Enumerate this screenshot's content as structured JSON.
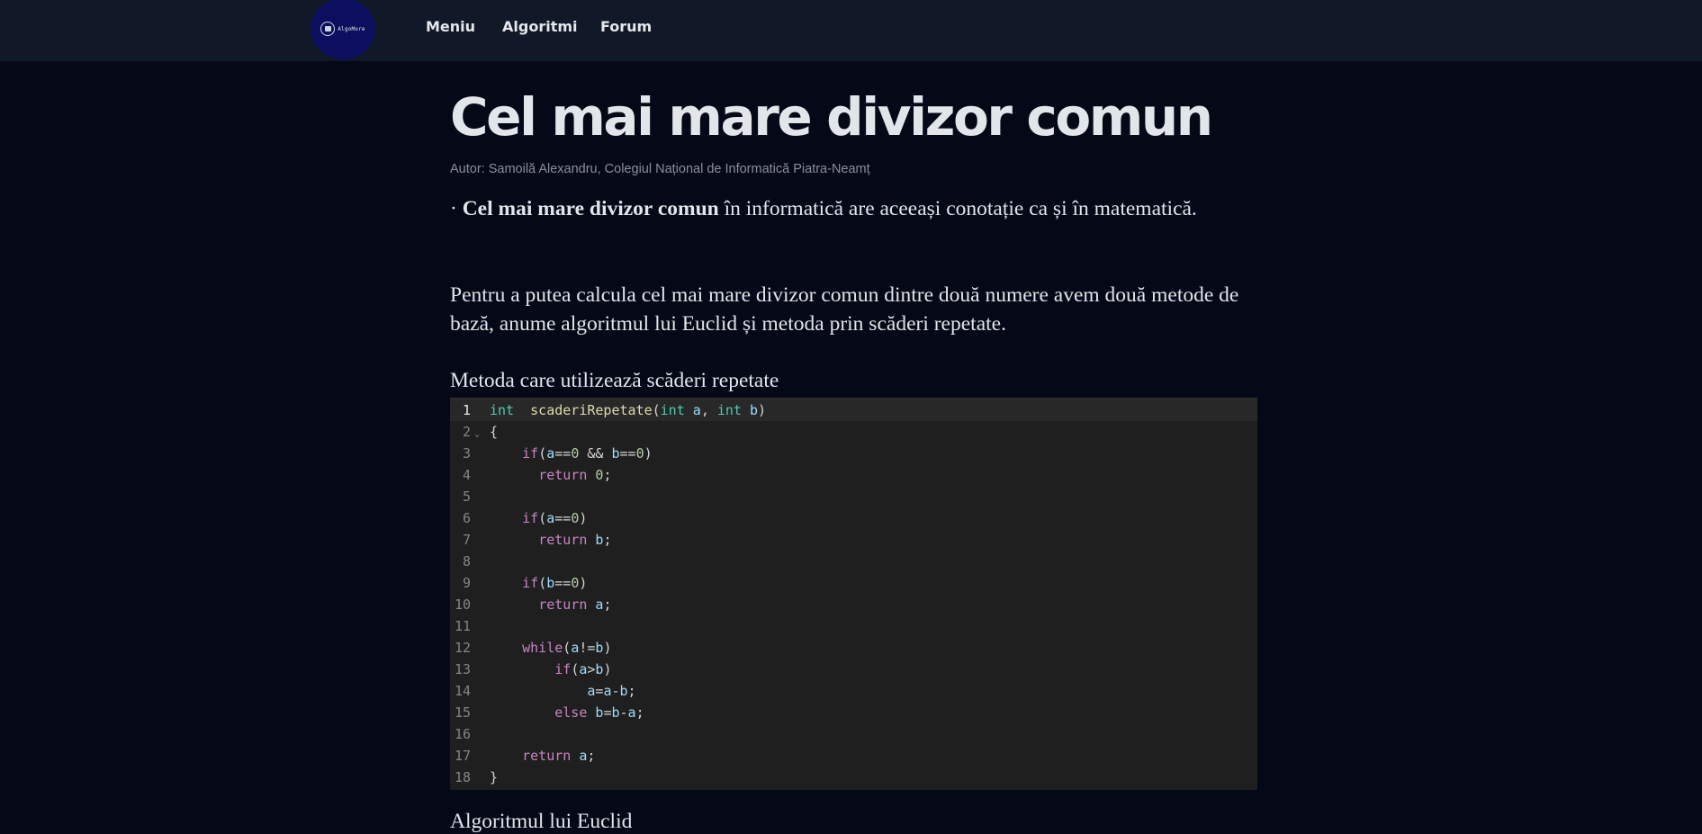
{
  "nav": {
    "logo_text": "AlgoMore",
    "links": [
      "Meniu",
      "Algoritmi",
      "Forum"
    ]
  },
  "article": {
    "title": "Cel mai mare divizor comun",
    "author": "Autor: Samoilă Alexandru, Colegiul Național de Informatică Piatra-Neamț",
    "intro_prefix": "· ",
    "intro_bold": "Cel mai mare divizor comun",
    "intro_rest": " în informatică are aceeași conotație ca și în matematică.",
    "para2": "Pentru a putea calcula cel mai mare divizor comun dintre două numere avem două metode de bază, anume algoritmul lui Euclid și metoda prin scăderi repetate.",
    "section1_title": "Metoda care utilizează scăderi repetate",
    "section2_title": "Algoritmul lui Euclid"
  },
  "code": {
    "active_line": 1,
    "lines": [
      {
        "n": "1",
        "fold": "",
        "tokens": [
          [
            "kw",
            "int"
          ],
          [
            "",
            "  "
          ],
          [
            "fn",
            "scaderiRepetate"
          ],
          [
            "",
            "("
          ],
          [
            "kw",
            "int"
          ],
          [
            "",
            " "
          ],
          [
            "var",
            "a"
          ],
          [
            "",
            ", "
          ],
          [
            "kw",
            "int"
          ],
          [
            "",
            " "
          ],
          [
            "var",
            "b"
          ],
          [
            "",
            ")"
          ]
        ]
      },
      {
        "n": "2",
        "fold": "⌄",
        "tokens": [
          [
            "",
            "{"
          ]
        ]
      },
      {
        "n": "3",
        "fold": "",
        "tokens": [
          [
            "",
            "    "
          ],
          [
            "ctl",
            "if"
          ],
          [
            "",
            "("
          ],
          [
            "var",
            "a"
          ],
          [
            "",
            "=="
          ],
          [
            "num",
            "0"
          ],
          [
            "",
            " && "
          ],
          [
            "var",
            "b"
          ],
          [
            "",
            "=="
          ],
          [
            "num",
            "0"
          ],
          [
            "",
            ")"
          ]
        ]
      },
      {
        "n": "4",
        "fold": "",
        "tokens": [
          [
            "",
            "      "
          ],
          [
            "ctl",
            "return"
          ],
          [
            "",
            " "
          ],
          [
            "num",
            "0"
          ],
          [
            "",
            ";"
          ]
        ]
      },
      {
        "n": "5",
        "fold": "",
        "tokens": []
      },
      {
        "n": "6",
        "fold": "",
        "tokens": [
          [
            "",
            "    "
          ],
          [
            "ctl",
            "if"
          ],
          [
            "",
            "("
          ],
          [
            "var",
            "a"
          ],
          [
            "",
            "=="
          ],
          [
            "num",
            "0"
          ],
          [
            "",
            ")"
          ]
        ]
      },
      {
        "n": "7",
        "fold": "",
        "tokens": [
          [
            "",
            "      "
          ],
          [
            "ctl",
            "return"
          ],
          [
            "",
            " "
          ],
          [
            "var",
            "b"
          ],
          [
            "",
            ";"
          ]
        ]
      },
      {
        "n": "8",
        "fold": "",
        "tokens": []
      },
      {
        "n": "9",
        "fold": "",
        "tokens": [
          [
            "",
            "    "
          ],
          [
            "ctl",
            "if"
          ],
          [
            "",
            "("
          ],
          [
            "var",
            "b"
          ],
          [
            "",
            "=="
          ],
          [
            "num",
            "0"
          ],
          [
            "",
            ")"
          ]
        ]
      },
      {
        "n": "10",
        "fold": "",
        "tokens": [
          [
            "",
            "      "
          ],
          [
            "ctl",
            "return"
          ],
          [
            "",
            " "
          ],
          [
            "var",
            "a"
          ],
          [
            "",
            ";"
          ]
        ]
      },
      {
        "n": "11",
        "fold": "",
        "tokens": []
      },
      {
        "n": "12",
        "fold": "",
        "tokens": [
          [
            "",
            "    "
          ],
          [
            "ctl",
            "while"
          ],
          [
            "",
            "("
          ],
          [
            "var",
            "a"
          ],
          [
            "",
            "!="
          ],
          [
            "var",
            "b"
          ],
          [
            "",
            ")"
          ]
        ]
      },
      {
        "n": "13",
        "fold": "",
        "tokens": [
          [
            "",
            "        "
          ],
          [
            "ctl",
            "if"
          ],
          [
            "",
            "("
          ],
          [
            "var",
            "a"
          ],
          [
            "",
            ">"
          ],
          [
            "var",
            "b"
          ],
          [
            "",
            ")"
          ]
        ]
      },
      {
        "n": "14",
        "fold": "",
        "tokens": [
          [
            "",
            "            "
          ],
          [
            "var",
            "a"
          ],
          [
            "",
            "="
          ],
          [
            "var",
            "a"
          ],
          [
            "",
            "-"
          ],
          [
            "var",
            "b"
          ],
          [
            "",
            ";"
          ]
        ]
      },
      {
        "n": "15",
        "fold": "",
        "tokens": [
          [
            "",
            "        "
          ],
          [
            "ctl",
            "else"
          ],
          [
            "",
            " "
          ],
          [
            "var",
            "b"
          ],
          [
            "",
            "="
          ],
          [
            "var",
            "b"
          ],
          [
            "",
            "-"
          ],
          [
            "var",
            "a"
          ],
          [
            "",
            ";"
          ]
        ]
      },
      {
        "n": "16",
        "fold": "",
        "tokens": []
      },
      {
        "n": "17",
        "fold": "",
        "tokens": [
          [
            "",
            "    "
          ],
          [
            "ctl",
            "return"
          ],
          [
            "",
            " "
          ],
          [
            "var",
            "a"
          ],
          [
            "",
            ";"
          ]
        ]
      },
      {
        "n": "18",
        "fold": "",
        "tokens": [
          [
            "",
            "}"
          ]
        ]
      }
    ]
  }
}
